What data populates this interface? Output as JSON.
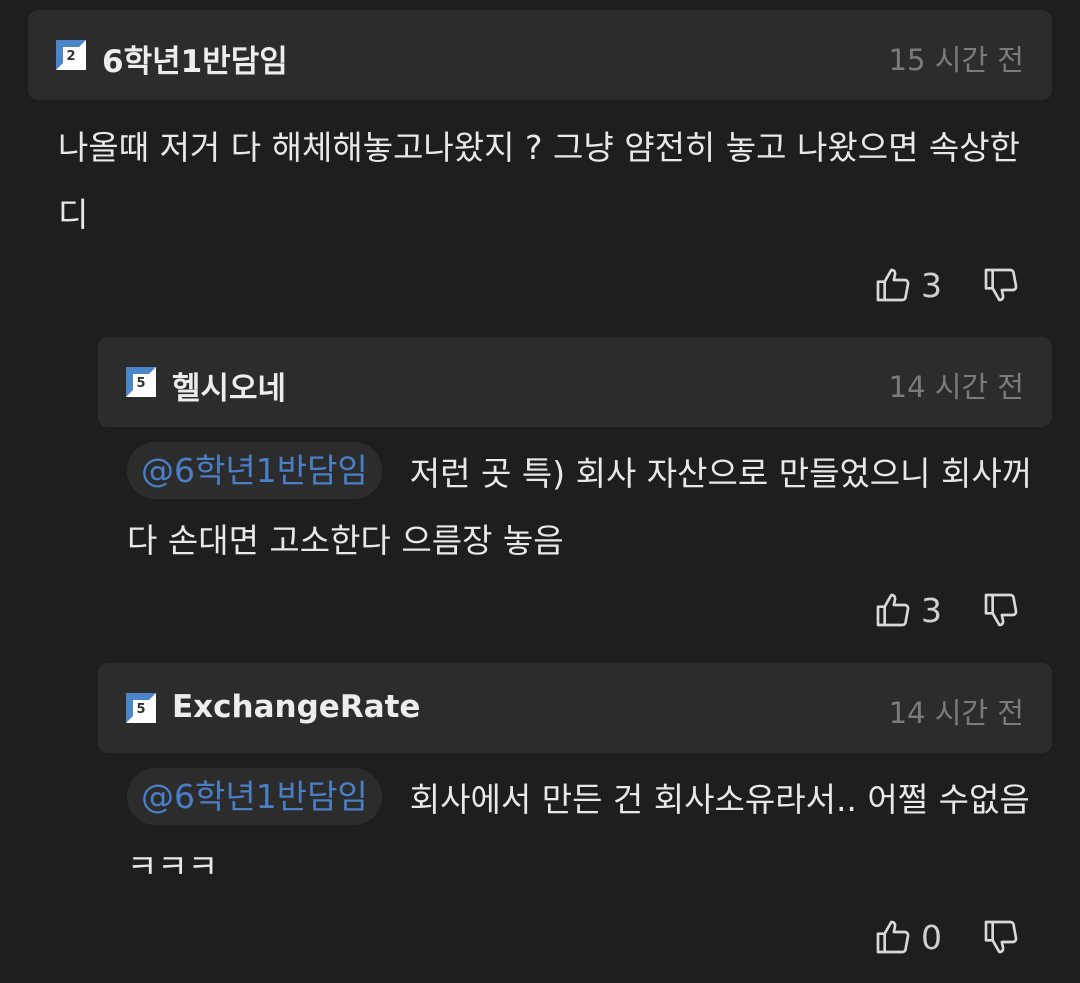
{
  "comments": [
    {
      "level_badge": "2",
      "author": "6학년1반담임",
      "time": "15 시간 전",
      "mention": "",
      "text": "나올때 저거 다 해체해놓고나왔지 ? 그냥 얌전히 놓고 나왔으면 속상한디",
      "like_count": "3"
    },
    {
      "level_badge": "5",
      "author": "헬시오네",
      "time": "14 시간 전",
      "mention": "@6학년1반담임",
      "text": "저런 곳 특) 회사 자산으로 만들었으니 회사꺼다 손대면 고소한다 으름장 놓음",
      "like_count": "3"
    },
    {
      "level_badge": "5",
      "author": "ExchangeRate",
      "time": "14 시간 전",
      "mention": "@6학년1반담임",
      "text": "회사에서 만든 건 회사소유라서.. 어쩔 수없음 ㅋㅋㅋ",
      "like_count": "0"
    }
  ],
  "icons": {
    "like": "thumbs-up-icon",
    "dislike": "thumbs-down-icon",
    "level": "level-badge-icon"
  },
  "colors": {
    "background": "#1e1e1e",
    "header": "#2c2c2c",
    "mention": "#4a7fc5",
    "time": "#7b7b7b"
  }
}
